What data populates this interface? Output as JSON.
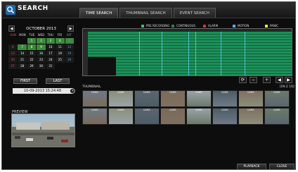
{
  "title": "SEARCH",
  "tabs": [
    {
      "label": "TIME SEARCH",
      "active": true
    },
    {
      "label": "THUMBNAIL SEARCH",
      "active": false
    },
    {
      "label": "EVENT SEARCH",
      "active": false
    }
  ],
  "calendar": {
    "month_label": "OCTOBER 2013",
    "weekdays": [
      "SUN",
      "MON",
      "TUE",
      "WED",
      "THU",
      "FRI",
      "SAT"
    ],
    "weeks": [
      [
        "",
        "",
        "1",
        "2",
        "3",
        "4",
        "5"
      ],
      [
        "6",
        "7",
        "8",
        "9",
        "10",
        "11",
        "12"
      ],
      [
        "13",
        "14",
        "15",
        "16",
        "17",
        "18",
        "19"
      ],
      [
        "20",
        "21",
        "22",
        "23",
        "24",
        "25",
        "26"
      ],
      [
        "27",
        "28",
        "29",
        "30",
        "31",
        "",
        ""
      ]
    ],
    "recorded_days": [
      "1",
      "2",
      "3",
      "4",
      "5",
      "7",
      "8",
      "9"
    ],
    "first_label": "FIRST",
    "last_label": "LAST",
    "datetime": "10-09-2013 15:24:48"
  },
  "legend": [
    {
      "label": "PRE RECORDING",
      "color": "#2ecc71"
    },
    {
      "label": "CONTINUOUS",
      "color": "#1f8a4c"
    },
    {
      "label": "ALARM",
      "color": "#e03030"
    },
    {
      "label": "MOTION",
      "color": "#4ab3e8"
    },
    {
      "label": "PANIC",
      "color": "#f2e630"
    }
  ],
  "thumbnail": {
    "label": "THUMBNAIL",
    "count": "[09.2 16]",
    "items": [
      {
        "label": "CAM1"
      },
      {
        "label": "CAM1"
      },
      {
        "label": "CAM1"
      },
      {
        "label": "CAM1"
      },
      {
        "label": "CAM1"
      },
      {
        "label": "CAM1"
      },
      {
        "label": "CAM1"
      },
      {
        "label": "CAM1"
      },
      {
        "label": "CAM1"
      },
      {
        "label": "CAM1"
      },
      {
        "label": "CAM1"
      },
      {
        "label": "CAM1"
      },
      {
        "label": "CAM1"
      },
      {
        "label": "CAM1"
      },
      {
        "label": "CAM1"
      },
      {
        "label": "CAM1"
      }
    ]
  },
  "preview_label": "PREVIEW",
  "footer": {
    "playback_label": "PLAYBACK",
    "close_label": "CLOSE"
  }
}
